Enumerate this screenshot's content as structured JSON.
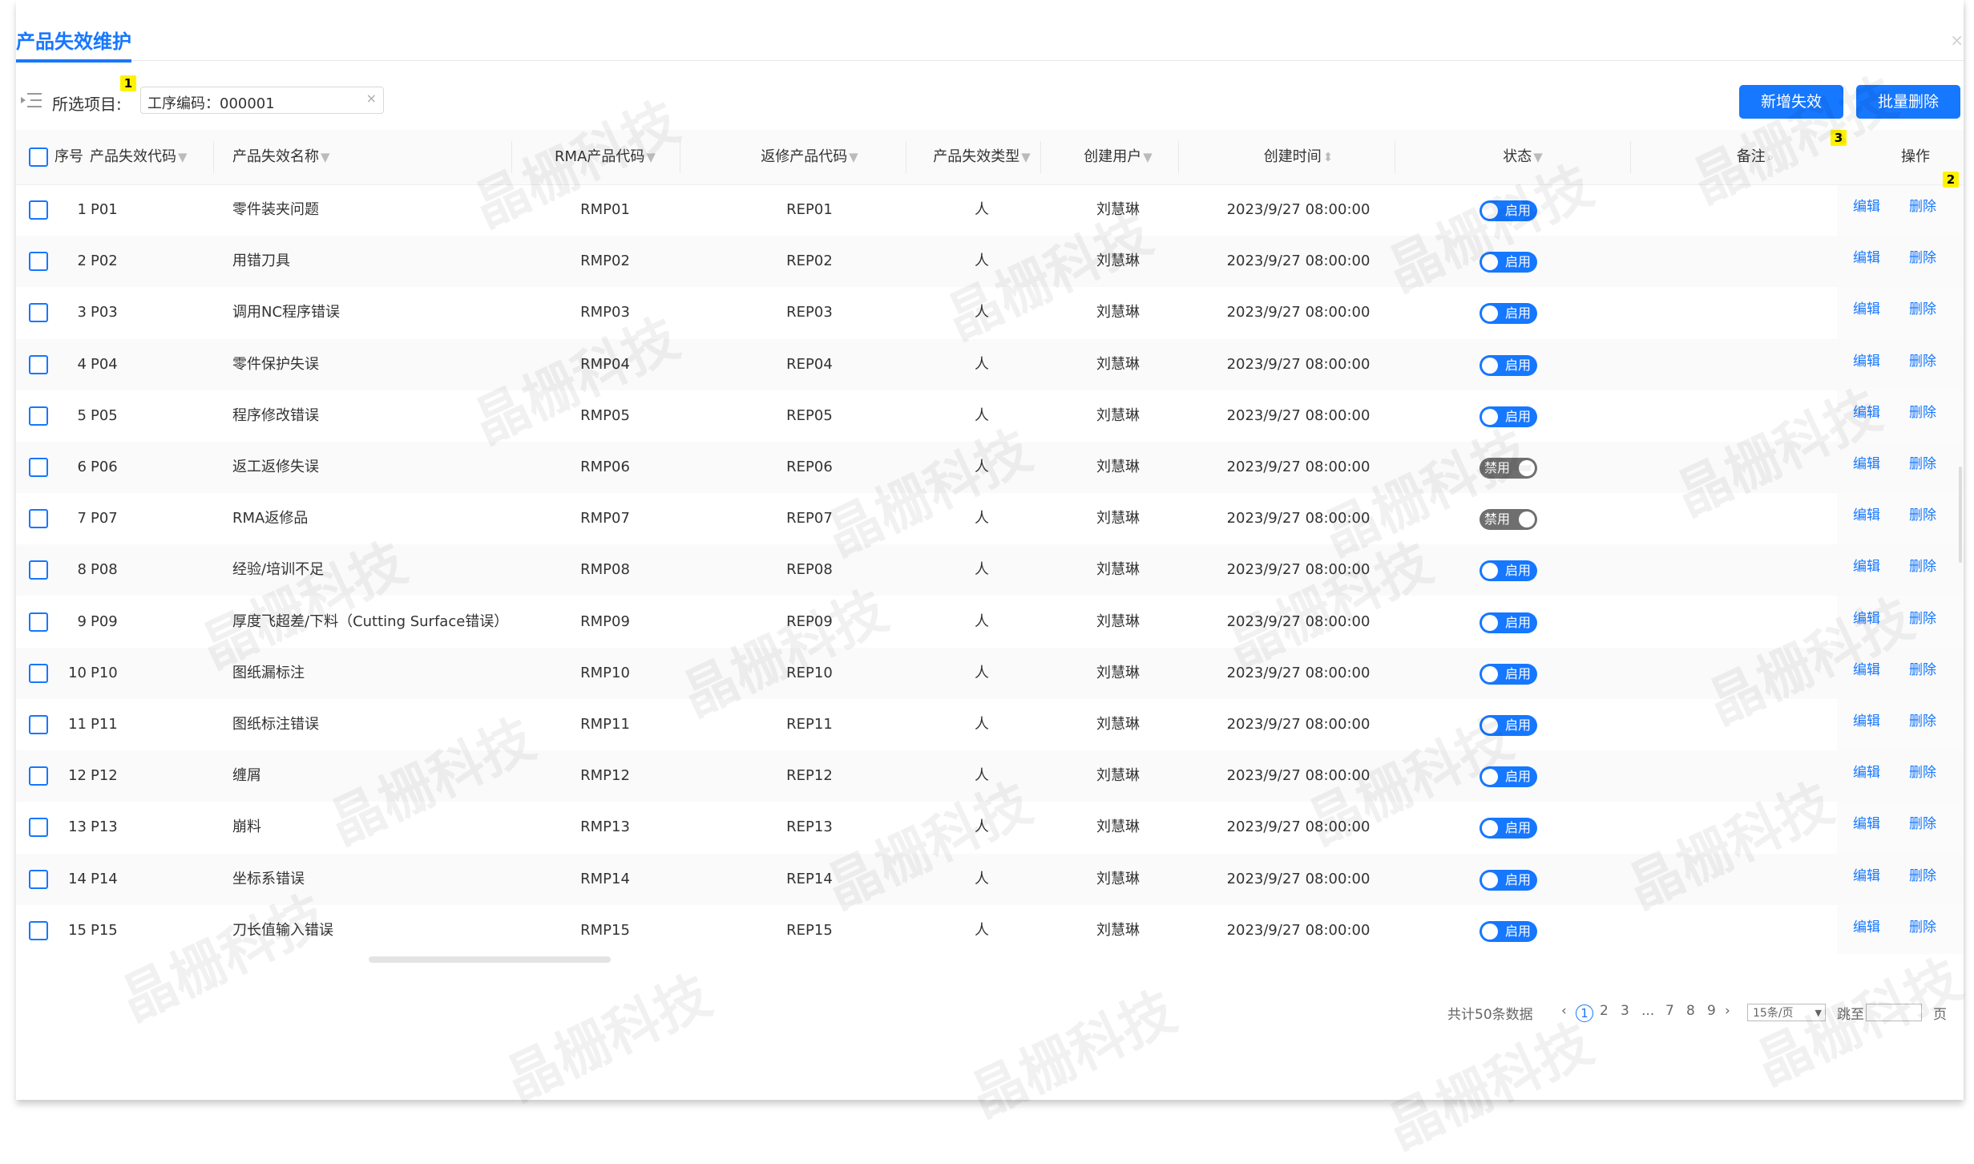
{
  "page": {
    "tab_title": "产品失效维护",
    "close_glyph": "×"
  },
  "filter": {
    "label": "所选项目:",
    "tag": "工序编码：000001",
    "tag_close": "×"
  },
  "toolbar": {
    "add_label": "新增失效",
    "batch_delete_label": "批量删除"
  },
  "markers": [
    "1",
    "2",
    "3"
  ],
  "columns": {
    "seq": "序号",
    "code": "产品失效代码",
    "name": "产品失效名称",
    "rma": "RMA产品代码",
    "rep": "返修产品代码",
    "type": "产品失效类型",
    "user": "创建用户",
    "time": "创建时间",
    "status": "状态",
    "remark": "备注",
    "ops": "操作"
  },
  "rows": [
    {
      "seq": "1",
      "code": "P01",
      "name": "零件装夹问题",
      "rma": "RMP01",
      "rep": "REP01",
      "type": "人",
      "user": "刘慧琳",
      "time": "2023/9/27 08:00:00",
      "status": "启用",
      "enabled": true
    },
    {
      "seq": "2",
      "code": "P02",
      "name": "用错刀具",
      "rma": "RMP02",
      "rep": "REP02",
      "type": "人",
      "user": "刘慧琳",
      "time": "2023/9/27 08:00:00",
      "status": "启用",
      "enabled": true
    },
    {
      "seq": "3",
      "code": "P03",
      "name": "调用NC程序错误",
      "rma": "RMP03",
      "rep": "REP03",
      "type": "人",
      "user": "刘慧琳",
      "time": "2023/9/27 08:00:00",
      "status": "启用",
      "enabled": true
    },
    {
      "seq": "4",
      "code": "P04",
      "name": "零件保护失误",
      "rma": "RMP04",
      "rep": "REP04",
      "type": "人",
      "user": "刘慧琳",
      "time": "2023/9/27 08:00:00",
      "status": "启用",
      "enabled": true
    },
    {
      "seq": "5",
      "code": "P05",
      "name": "程序修改错误",
      "rma": "RMP05",
      "rep": "REP05",
      "type": "人",
      "user": "刘慧琳",
      "time": "2023/9/27 08:00:00",
      "status": "启用",
      "enabled": true
    },
    {
      "seq": "6",
      "code": "P06",
      "name": "返工返修失误",
      "rma": "RMP06",
      "rep": "REP06",
      "type": "人",
      "user": "刘慧琳",
      "time": "2023/9/27 08:00:00",
      "status": "禁用",
      "enabled": false
    },
    {
      "seq": "7",
      "code": "P07",
      "name": "RMA返修品",
      "rma": "RMP07",
      "rep": "REP07",
      "type": "人",
      "user": "刘慧琳",
      "time": "2023/9/27 08:00:00",
      "status": "禁用",
      "enabled": false
    },
    {
      "seq": "8",
      "code": "P08",
      "name": "经验/培训不足",
      "rma": "RMP08",
      "rep": "REP08",
      "type": "人",
      "user": "刘慧琳",
      "time": "2023/9/27 08:00:00",
      "status": "启用",
      "enabled": true
    },
    {
      "seq": "9",
      "code": "P09",
      "name": "厚度飞超差/下料（Cutting Surface错误）",
      "rma": "RMP09",
      "rep": "REP09",
      "type": "人",
      "user": "刘慧琳",
      "time": "2023/9/27 08:00:00",
      "status": "启用",
      "enabled": true
    },
    {
      "seq": "10",
      "code": "P10",
      "name": "图纸漏标注",
      "rma": "RMP10",
      "rep": "REP10",
      "type": "人",
      "user": "刘慧琳",
      "time": "2023/9/27 08:00:00",
      "status": "启用",
      "enabled": true
    },
    {
      "seq": "11",
      "code": "P11",
      "name": "图纸标注错误",
      "rma": "RMP11",
      "rep": "REP11",
      "type": "人",
      "user": "刘慧琳",
      "time": "2023/9/27 08:00:00",
      "status": "启用",
      "enabled": true
    },
    {
      "seq": "12",
      "code": "P12",
      "name": "缠屑",
      "rma": "RMP12",
      "rep": "REP12",
      "type": "人",
      "user": "刘慧琳",
      "time": "2023/9/27 08:00:00",
      "status": "启用",
      "enabled": true
    },
    {
      "seq": "13",
      "code": "P13",
      "name": "崩料",
      "rma": "RMP13",
      "rep": "REP13",
      "type": "人",
      "user": "刘慧琳",
      "time": "2023/9/27 08:00:00",
      "status": "启用",
      "enabled": true
    },
    {
      "seq": "14",
      "code": "P14",
      "name": "坐标系错误",
      "rma": "RMP14",
      "rep": "REP14",
      "type": "人",
      "user": "刘慧琳",
      "time": "2023/9/27 08:00:00",
      "status": "启用",
      "enabled": true
    },
    {
      "seq": "15",
      "code": "P15",
      "name": "刀长值输入错误",
      "rma": "RMP15",
      "rep": "REP15",
      "type": "人",
      "user": "刘慧琳",
      "time": "2023/9/27 08:00:00",
      "status": "启用",
      "enabled": true
    }
  ],
  "row_actions": {
    "edit": "编辑",
    "delete": "删除"
  },
  "pagination": {
    "total": "共计50条数据",
    "prev": "‹",
    "pages": [
      "1",
      "2",
      "3",
      "...",
      "7",
      "8",
      "9"
    ],
    "current": "1",
    "next": "›",
    "page_size": "15条/页",
    "jump_label": "跳至",
    "jump_unit": "页"
  },
  "watermark_text": "晶栅科技",
  "colors": {
    "accent": "#1677ff",
    "disabled_toggle": "#6f6f6f",
    "marker": "#fff200"
  },
  "icons": {
    "filter": "filter-icon",
    "sort": "sort-icon",
    "search": "search-icon",
    "select": "chevron-down-icon"
  }
}
